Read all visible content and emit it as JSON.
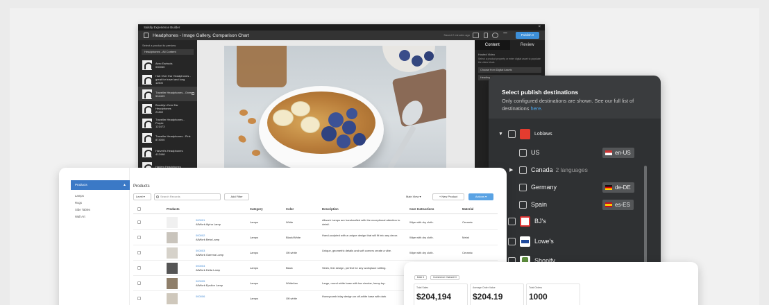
{
  "experience_builder": {
    "app_title": "Salsify Experience Builder",
    "close": "×",
    "doc_title": "Headphones - Image Gallery, Comparison Chart",
    "saved_text": "Saved 2 minutes ago",
    "publish_label": "Publish ▾",
    "left": {
      "label": "Select a product to preview",
      "select_value": "Headphones - All Content",
      "items": [
        {
          "name": "Aero Earbuds",
          "id": "030060",
          "active": false
        },
        {
          "name": "Hub Over Ear Headphones - great for travel and long",
          "id": "11900",
          "active": false
        },
        {
          "name": "Traveller Headphones - Green",
          "id": "504409",
          "active": true
        },
        {
          "name": "Brooklyn Over Ear Headphones",
          "id": "21802",
          "active": false
        },
        {
          "name": "Traveller Headphones - Purple",
          "id": "121473",
          "active": false
        },
        {
          "name": "Traveller Headphones - Pink",
          "id": "874000",
          "active": false
        },
        {
          "name": "Harvett's Headphones",
          "id": "412498",
          "active": false
        },
        {
          "name": "Harlem Headphones",
          "id": "",
          "active": false
        }
      ]
    },
    "right": {
      "tabs": [
        "Content",
        "Review"
      ],
      "label": "Hosted Video",
      "text": "Select a product property or enter digital asset to populate the video block.",
      "field1": "Choose from Digital Assets",
      "field2": "Heading"
    }
  },
  "publish_panel": {
    "heading": "Select publish destinations",
    "subtitle": "Only configured destinations are shown. See our full list of destinations",
    "subtitle_link": "here.",
    "rows": [
      {
        "label": "Loblaws",
        "type": "group-expanded"
      },
      {
        "label": "US",
        "locale": "en-US",
        "type": "child"
      },
      {
        "label": "Canada",
        "sub": "2 languages",
        "type": "group-collapsed"
      },
      {
        "label": "Germany",
        "locale": "de-DE",
        "type": "child"
      },
      {
        "label": "Spain",
        "locale": "es-ES",
        "type": "child"
      },
      {
        "label": "BJ's",
        "type": "retailer"
      },
      {
        "label": "Lowe's",
        "type": "retailer"
      },
      {
        "label": "Shopify",
        "type": "retailer"
      }
    ]
  },
  "products_card": {
    "sidebar": {
      "active": "Products",
      "items": [
        "Lamps",
        "Rugs",
        "Side Tables",
        "Wall Art"
      ]
    },
    "title": "Products",
    "level_label": "Level ▾",
    "search_placeholder": "Search Records",
    "add_filter": "Add Filter",
    "main_view": "Main View ▾",
    "new_product": "+ New Product",
    "actions": "Actions ▾",
    "columns": [
      "Products",
      "Category",
      "Color",
      "Description",
      "Care Instructions",
      "Material"
    ],
    "rows": [
      {
        "id": "000001",
        "name": "AllWork Alpha Lamp",
        "category": "Lamps",
        "color": "White",
        "description": "Allwork Lamps are handcrafted with the exceptional attention to detail.",
        "care": "Wipe with dry cloth.",
        "material": "Ceramic"
      },
      {
        "id": "000002",
        "name": "AllWork Beta Lamp",
        "category": "Lamps",
        "color": "Black/White",
        "description": "Hand-sculpted with a unique design that will fit into any decor.",
        "care": "Wipe with dry cloth.",
        "material": "Metal"
      },
      {
        "id": "000003",
        "name": "AllWork Gamma Lamp",
        "category": "Lamps",
        "color": "Off-white",
        "description": "Unique, geometric details and soft corners create a vibe.",
        "care": "Wipe with dry cloth.",
        "material": "Ceramic"
      },
      {
        "id": "000004",
        "name": "AllWork Delta Lamp",
        "category": "Lamps",
        "color": "Black",
        "description": "Sleek, thin design, perfect for any workplace setting.",
        "care": "Wipe with dry cloth.",
        "material": "Ceramic"
      },
      {
        "id": "000005",
        "name": "AllWork Epsilon Lamp",
        "category": "Lamps",
        "color": "White/tan",
        "description": "Large, round white base with tan circular, hemp top.",
        "care": "Wipe with dry cloth.",
        "material": "Ceramic"
      },
      {
        "id": "000006",
        "name": "",
        "category": "Lamps",
        "color": "Off-white",
        "description": "Honeycomb inlay design on off-white base with dark",
        "care": "",
        "material": ""
      }
    ]
  },
  "analytics_card": {
    "chips": [
      "Date ▾",
      "Commerce Channel ▾"
    ],
    "stats": [
      {
        "label": "Total Sales",
        "value": "$204,194"
      },
      {
        "label": "Average Order Value",
        "value": "$204.19"
      },
      {
        "label": "Total Orders",
        "value": "1000"
      }
    ]
  },
  "colors": {
    "publish_blue": "#3d8fd8",
    "link_blue": "#4aa3e8",
    "sidebar_active": "#3b79c6",
    "dark_panel": "#2f3133"
  }
}
